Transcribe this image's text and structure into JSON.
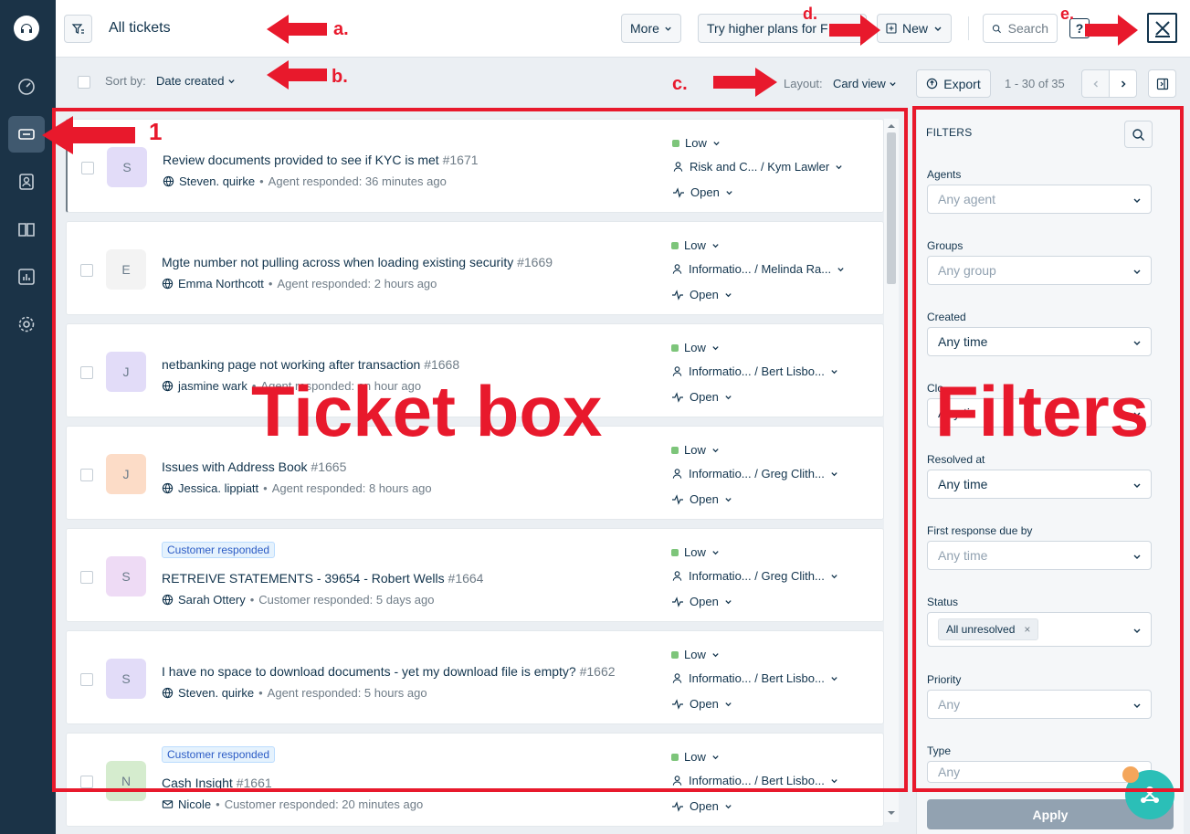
{
  "header": {
    "title": "All tickets",
    "more_label": "More",
    "upgrade_label": "Try higher plans for F",
    "new_label": "New",
    "search_label": "Search"
  },
  "toolbar": {
    "sort_label": "Sort by:",
    "sort_value": "Date created",
    "layout_label": "Layout:",
    "layout_value": "Card view",
    "export_label": "Export",
    "pagination": "1 - 30 of 35"
  },
  "tickets": [
    {
      "initial": "S",
      "avatar_color": "#e2dcf8",
      "tag": "",
      "subject": "Review documents provided to see if KYC is met",
      "number": "#1671",
      "channel": "globe",
      "requester": "Steven. quirke",
      "activity": "Agent responded: 36 minutes ago",
      "priority": "Low",
      "group": "Risk and C... / Kym Lawler",
      "status": "Open"
    },
    {
      "initial": "E",
      "avatar_color": "#f3f3f3",
      "tag": "",
      "subject": "Mgte number not pulling across when loading existing security",
      "number": "#1669",
      "channel": "globe",
      "requester": "Emma Northcott",
      "activity": "Agent responded: 2 hours ago",
      "priority": "Low",
      "group": "Informatio... / Melinda Ra...",
      "status": "Open"
    },
    {
      "initial": "J",
      "avatar_color": "#e2dcf8",
      "tag": "",
      "subject": "netbanking page not working after transaction",
      "number": "#1668",
      "channel": "globe",
      "requester": "jasmine wark",
      "activity": "Agent responded: an hour ago",
      "priority": "Low",
      "group": "Informatio... / Bert Lisbo...",
      "status": "Open"
    },
    {
      "initial": "J",
      "avatar_color": "#fcdcc7",
      "tag": "",
      "subject": "Issues with Address Book",
      "number": "#1665",
      "channel": "globe",
      "requester": "Jessica. lippiatt",
      "activity": "Agent responded: 8 hours ago",
      "priority": "Low",
      "group": "Informatio... / Greg Clith...",
      "status": "Open"
    },
    {
      "initial": "S",
      "avatar_color": "#eedbf5",
      "tag": "Customer responded",
      "subject": "RETREIVE STATEMENTS - 39654 - Robert Wells",
      "number": "#1664",
      "channel": "globe",
      "requester": "Sarah Ottery",
      "activity": "Customer responded: 5 days ago",
      "priority": "Low",
      "group": "Informatio... / Greg Clith...",
      "status": "Open"
    },
    {
      "initial": "S",
      "avatar_color": "#e2dcf8",
      "tag": "",
      "subject": "I have no space to download documents - yet my download file is empty?",
      "number": "#1662",
      "channel": "globe",
      "requester": "Steven. quirke",
      "activity": "Agent responded: 5 hours ago",
      "priority": "Low",
      "group": "Informatio... / Bert Lisbo...",
      "status": "Open"
    },
    {
      "initial": "N",
      "avatar_color": "#d5ecce",
      "tag": "Customer responded",
      "subject": "Cash Insight",
      "number": "#1661",
      "channel": "email",
      "requester": "Nicole",
      "activity": "Customer responded: 20 minutes ago",
      "priority": "Low",
      "group": "Informatio... / Bert Lisbo...",
      "status": "Open"
    }
  ],
  "filters": {
    "title": "FILTERS",
    "fields": [
      {
        "label": "Agents",
        "value": "Any agent",
        "set": false
      },
      {
        "label": "Groups",
        "value": "Any group",
        "set": false
      },
      {
        "label": "Created",
        "value": "Any time",
        "set": true
      },
      {
        "label": "Clo",
        "value": "Any ti",
        "set": true
      },
      {
        "label": "Resolved at",
        "value": "Any time",
        "set": true
      },
      {
        "label": "First response due by",
        "value": "Any time",
        "set": false
      },
      {
        "label": "Status",
        "value": "All unresolved",
        "set": true,
        "chip": true
      },
      {
        "label": "Priority",
        "value": "Any",
        "set": false
      },
      {
        "label": "Type",
        "value": "Any",
        "set": false
      }
    ],
    "apply_label": "Apply"
  },
  "annotations": {
    "a": "a.",
    "b": "b.",
    "c": "c.",
    "d": "d.",
    "e": "e.",
    "one": "1",
    "ticket_box": "Ticket box",
    "filters": "Filters",
    "color": "#e8192c"
  },
  "icons": {
    "rail": [
      "dashboard-icon",
      "tickets-icon",
      "contacts-icon",
      "solutions-icon",
      "reports-icon",
      "admin-icon"
    ]
  }
}
